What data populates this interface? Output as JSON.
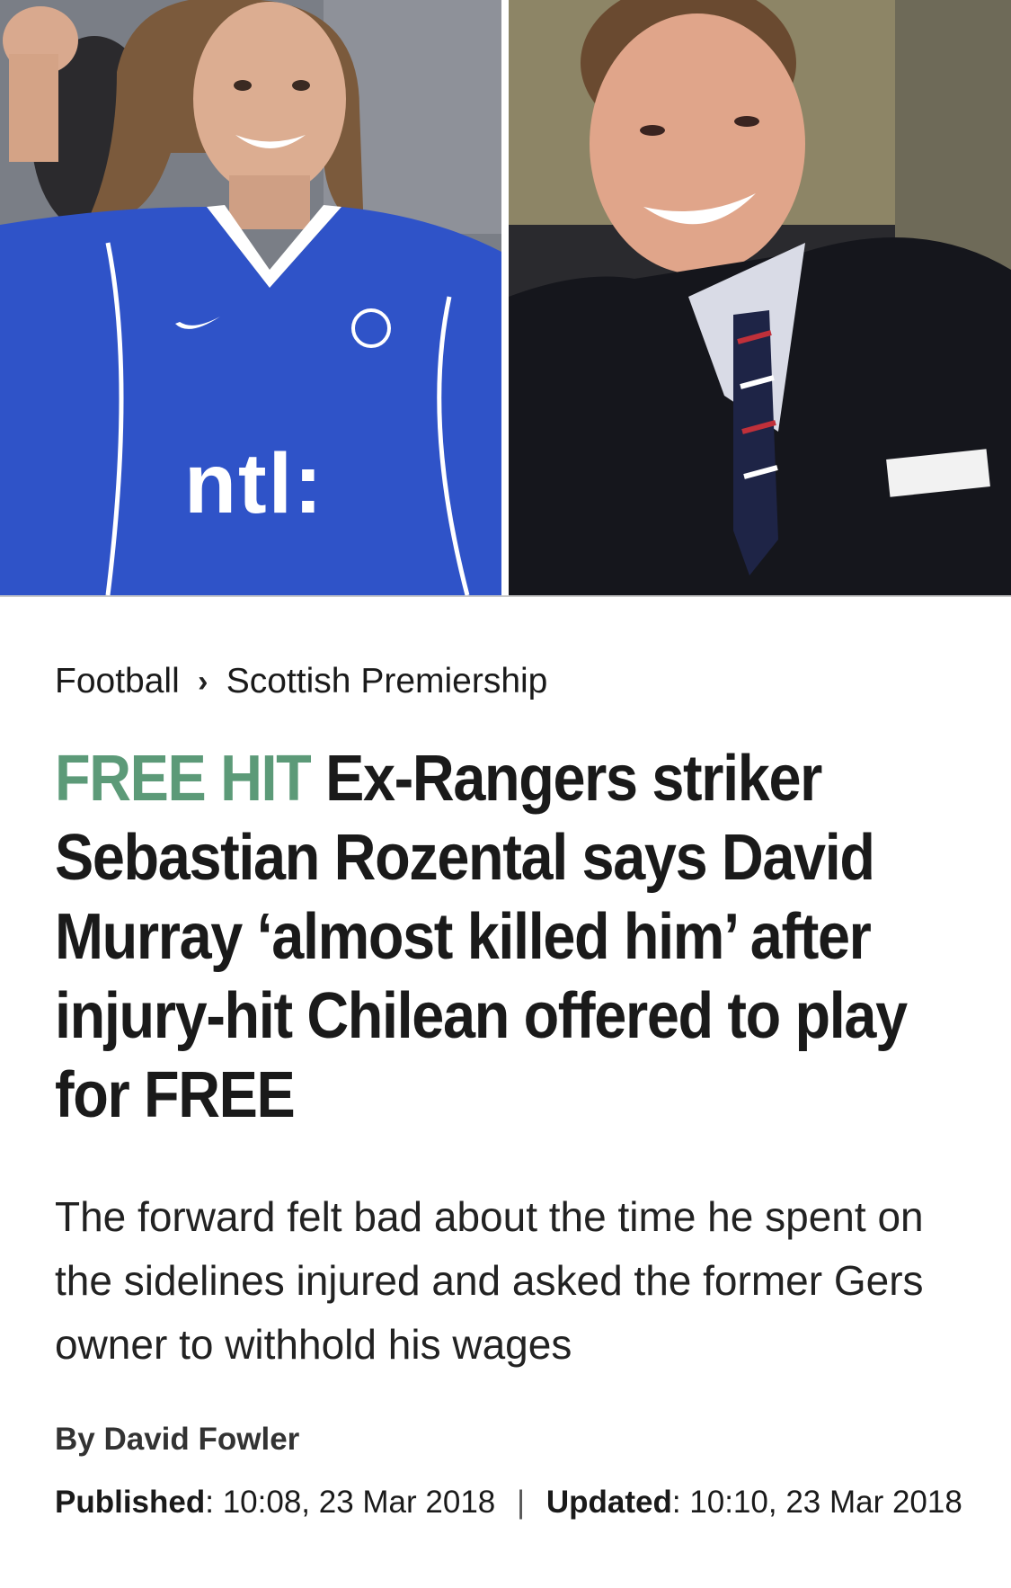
{
  "hero": {
    "left_photo_alt": "Sebastian Rozental celebrating in Rangers kit",
    "right_photo_alt": "David Murray smiling",
    "shirt_sponsor": "ntl:"
  },
  "breadcrumb": {
    "section": "Football",
    "subsection": "Scottish Premiership"
  },
  "headline": {
    "kicker": "FREE HIT",
    "text": "Ex-Rangers striker Sebastian Rozental says David Murray ‘almost killed him’ after injury-hit Chilean offered to play for FREE"
  },
  "standfirst": "The forward felt bad about the time he spent on the sidelines injured and asked the former Gers owner to withhold his wages",
  "byline": "By David Fowler",
  "dates": {
    "published_label": "Published",
    "published_value": "10:08, 23 Mar 2018",
    "updated_label": "Updated",
    "updated_value": "10:10, 23 Mar 2018"
  },
  "colors": {
    "kicker": "#5c9a78",
    "text": "#1a1a1a"
  }
}
